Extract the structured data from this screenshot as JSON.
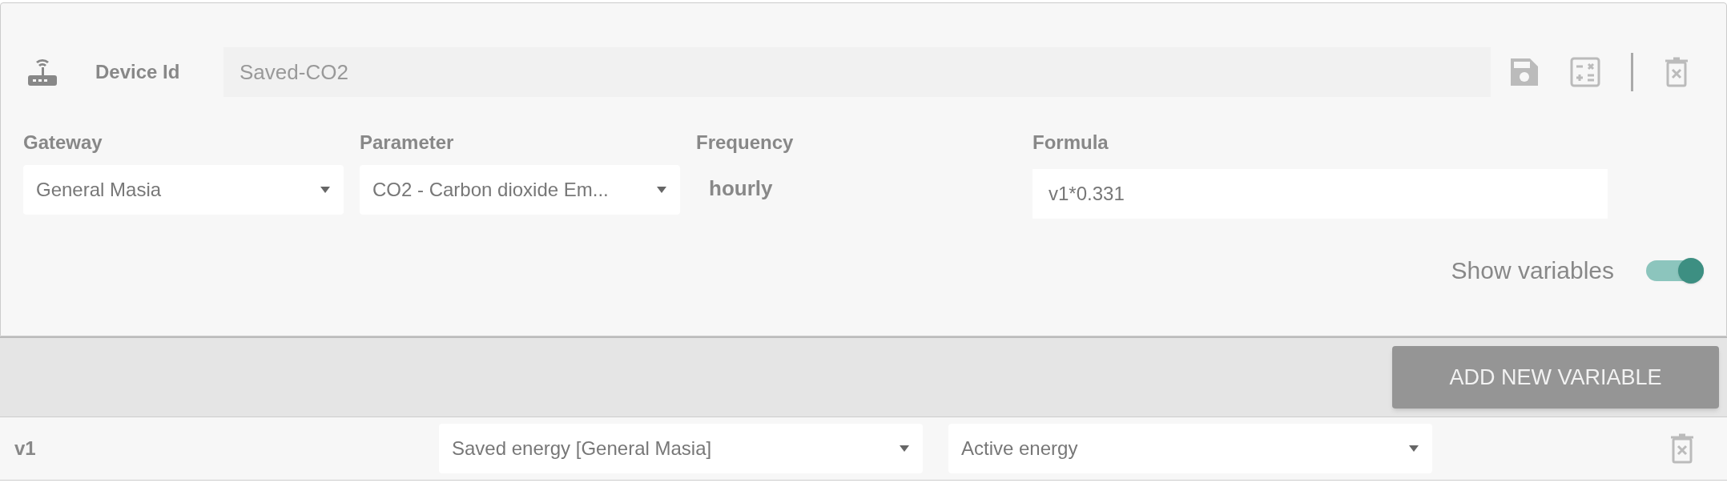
{
  "header": {
    "label": "Device Id",
    "device_id": "Saved-CO2"
  },
  "fields": [
    {
      "kind": "select",
      "label": "Gateway",
      "value": "General Masia"
    },
    {
      "kind": "select",
      "label": "Parameter",
      "value": "CO2 - Carbon dioxide Em..."
    },
    {
      "kind": "text",
      "label": "Frequency",
      "value": "hourly"
    },
    {
      "kind": "input",
      "label": "Formula",
      "value": "v1*0.331"
    }
  ],
  "show_variables": {
    "label": "Show variables",
    "on": true
  },
  "add_button": "ADD NEW VARIABLE",
  "variables": [
    {
      "name": "v1",
      "source": "Saved energy [General Masia]",
      "parameter": "Active energy"
    }
  ]
}
